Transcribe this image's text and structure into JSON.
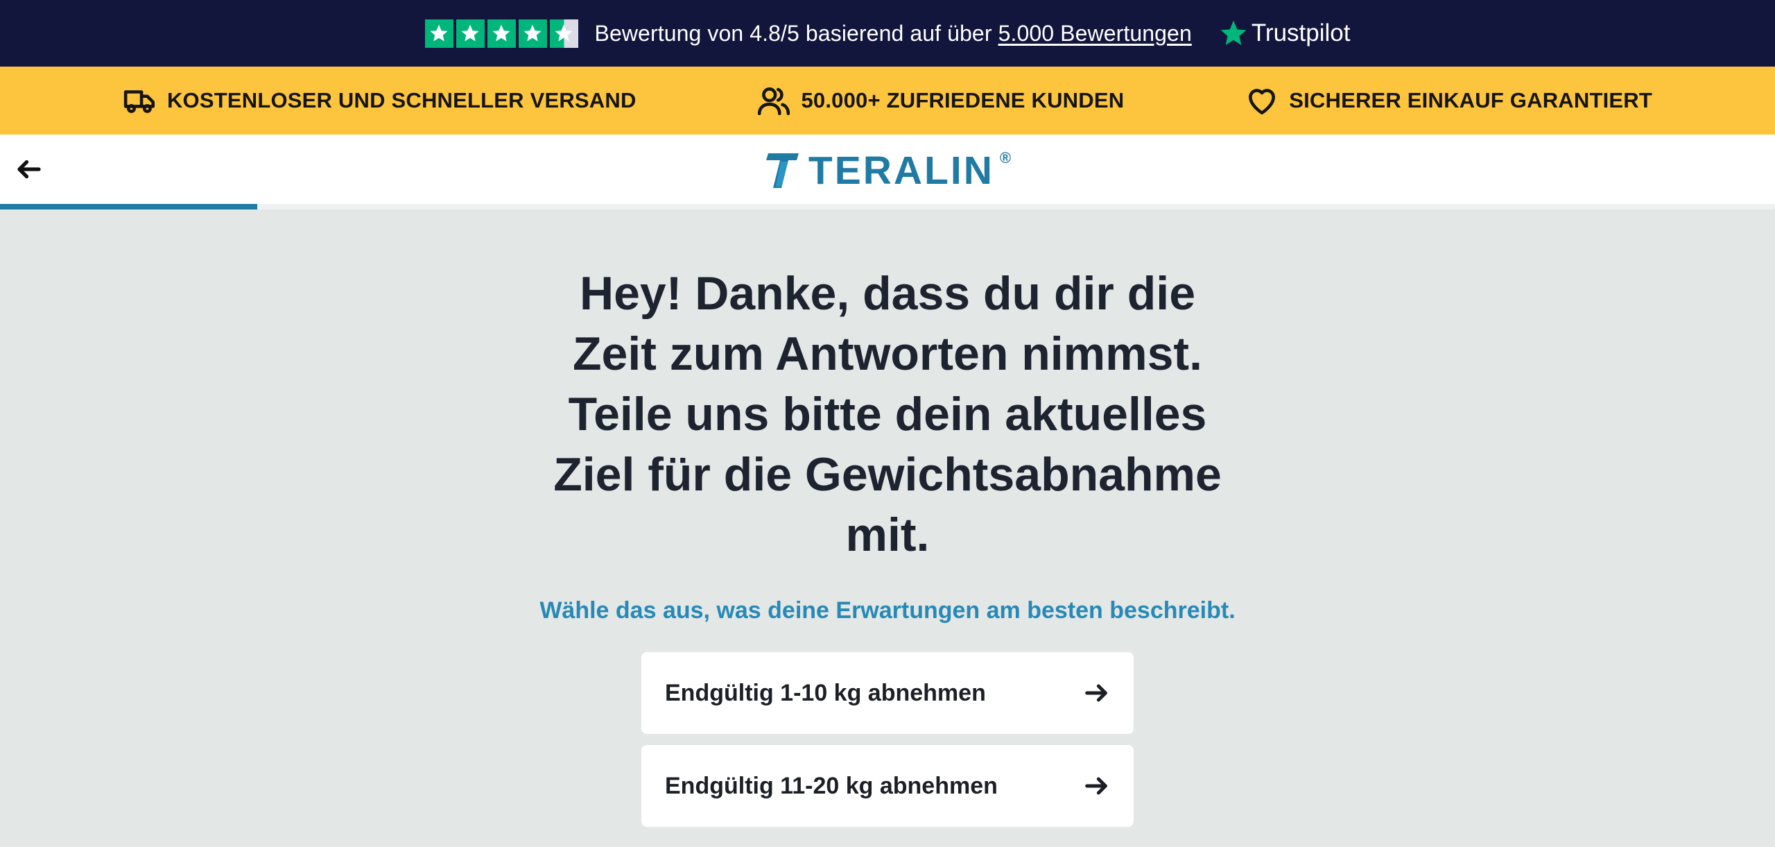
{
  "trust_bar": {
    "rating_prefix": "Bewertung von 4.8/5 basierend auf über",
    "rating_link": "5.000 Bewertungen",
    "brand": "Trustpilot",
    "stars_rating": 4.5,
    "star_color": "#00b67a",
    "background": "#12163d"
  },
  "benefits": [
    {
      "icon": "truck-icon",
      "label": "KOSTENLOSER UND SCHNELLER VERSAND"
    },
    {
      "icon": "users-icon",
      "label": "50.000+ ZUFRIEDENE KUNDEN"
    },
    {
      "icon": "heart-icon",
      "label": "SICHERER EINKAUF GARANTIERT"
    }
  ],
  "header": {
    "back_icon": "arrow-left-icon",
    "logo_text": "TERALIN",
    "logo_reg": "®",
    "brand_color": "#1f7aa4",
    "progress": 0.145
  },
  "main": {
    "headline": "Hey! Danke, dass du dir die Zeit zum Antworten nimmst. Teile uns bitte dein aktuelles Ziel für die Gewichtsabnahme mit.",
    "subline": "Wähle das aus, was deine Erwartungen am besten beschreibt.",
    "options": [
      {
        "label": "Endgültig 1-10 kg abnehmen",
        "icon": "arrow-right-icon"
      },
      {
        "label": "Endgültig 11-20 kg abnehmen",
        "icon": "arrow-right-icon"
      }
    ]
  }
}
